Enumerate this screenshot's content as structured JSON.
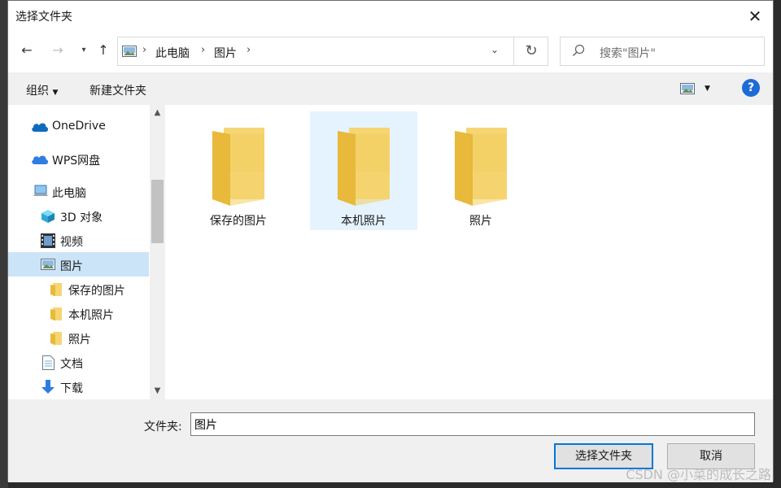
{
  "dialog": {
    "title": "选择文件夹"
  },
  "nav": {
    "breadcrumb": [
      "此电脑",
      "图片"
    ],
    "search_placeholder": "搜索\"图片\""
  },
  "toolbar": {
    "organize": "组织",
    "new_folder": "新建文件夹"
  },
  "tree": {
    "items": [
      {
        "label": "OneDrive",
        "icon": "cloud-icon"
      },
      {
        "label": "WPS网盘",
        "icon": "cloud-icon"
      },
      {
        "label": "此电脑",
        "icon": "computer-icon"
      },
      {
        "label": "3D 对象",
        "icon": "cube-icon"
      },
      {
        "label": "视频",
        "icon": "film-icon"
      },
      {
        "label": "图片",
        "icon": "picture-icon",
        "selected": true
      },
      {
        "label": "保存的图片",
        "icon": "folder-icon"
      },
      {
        "label": "本机照片",
        "icon": "folder-icon"
      },
      {
        "label": "照片",
        "icon": "folder-icon"
      },
      {
        "label": "文档",
        "icon": "document-icon"
      },
      {
        "label": "下载",
        "icon": "download-icon"
      }
    ]
  },
  "folders": [
    {
      "name": "保存的图片"
    },
    {
      "name": "本机照片",
      "selected": true
    },
    {
      "name": "照片"
    }
  ],
  "footer": {
    "folder_label": "文件夹:",
    "folder_value": "图片",
    "select_button": "选择文件夹",
    "cancel_button": "取消"
  },
  "watermark": "CSDN @小菜的成长之路",
  "colors": {
    "accent": "#0078d7",
    "selection": "#cce4f7",
    "tile_selection": "#e5f3ff",
    "folder": "#f6d573"
  }
}
